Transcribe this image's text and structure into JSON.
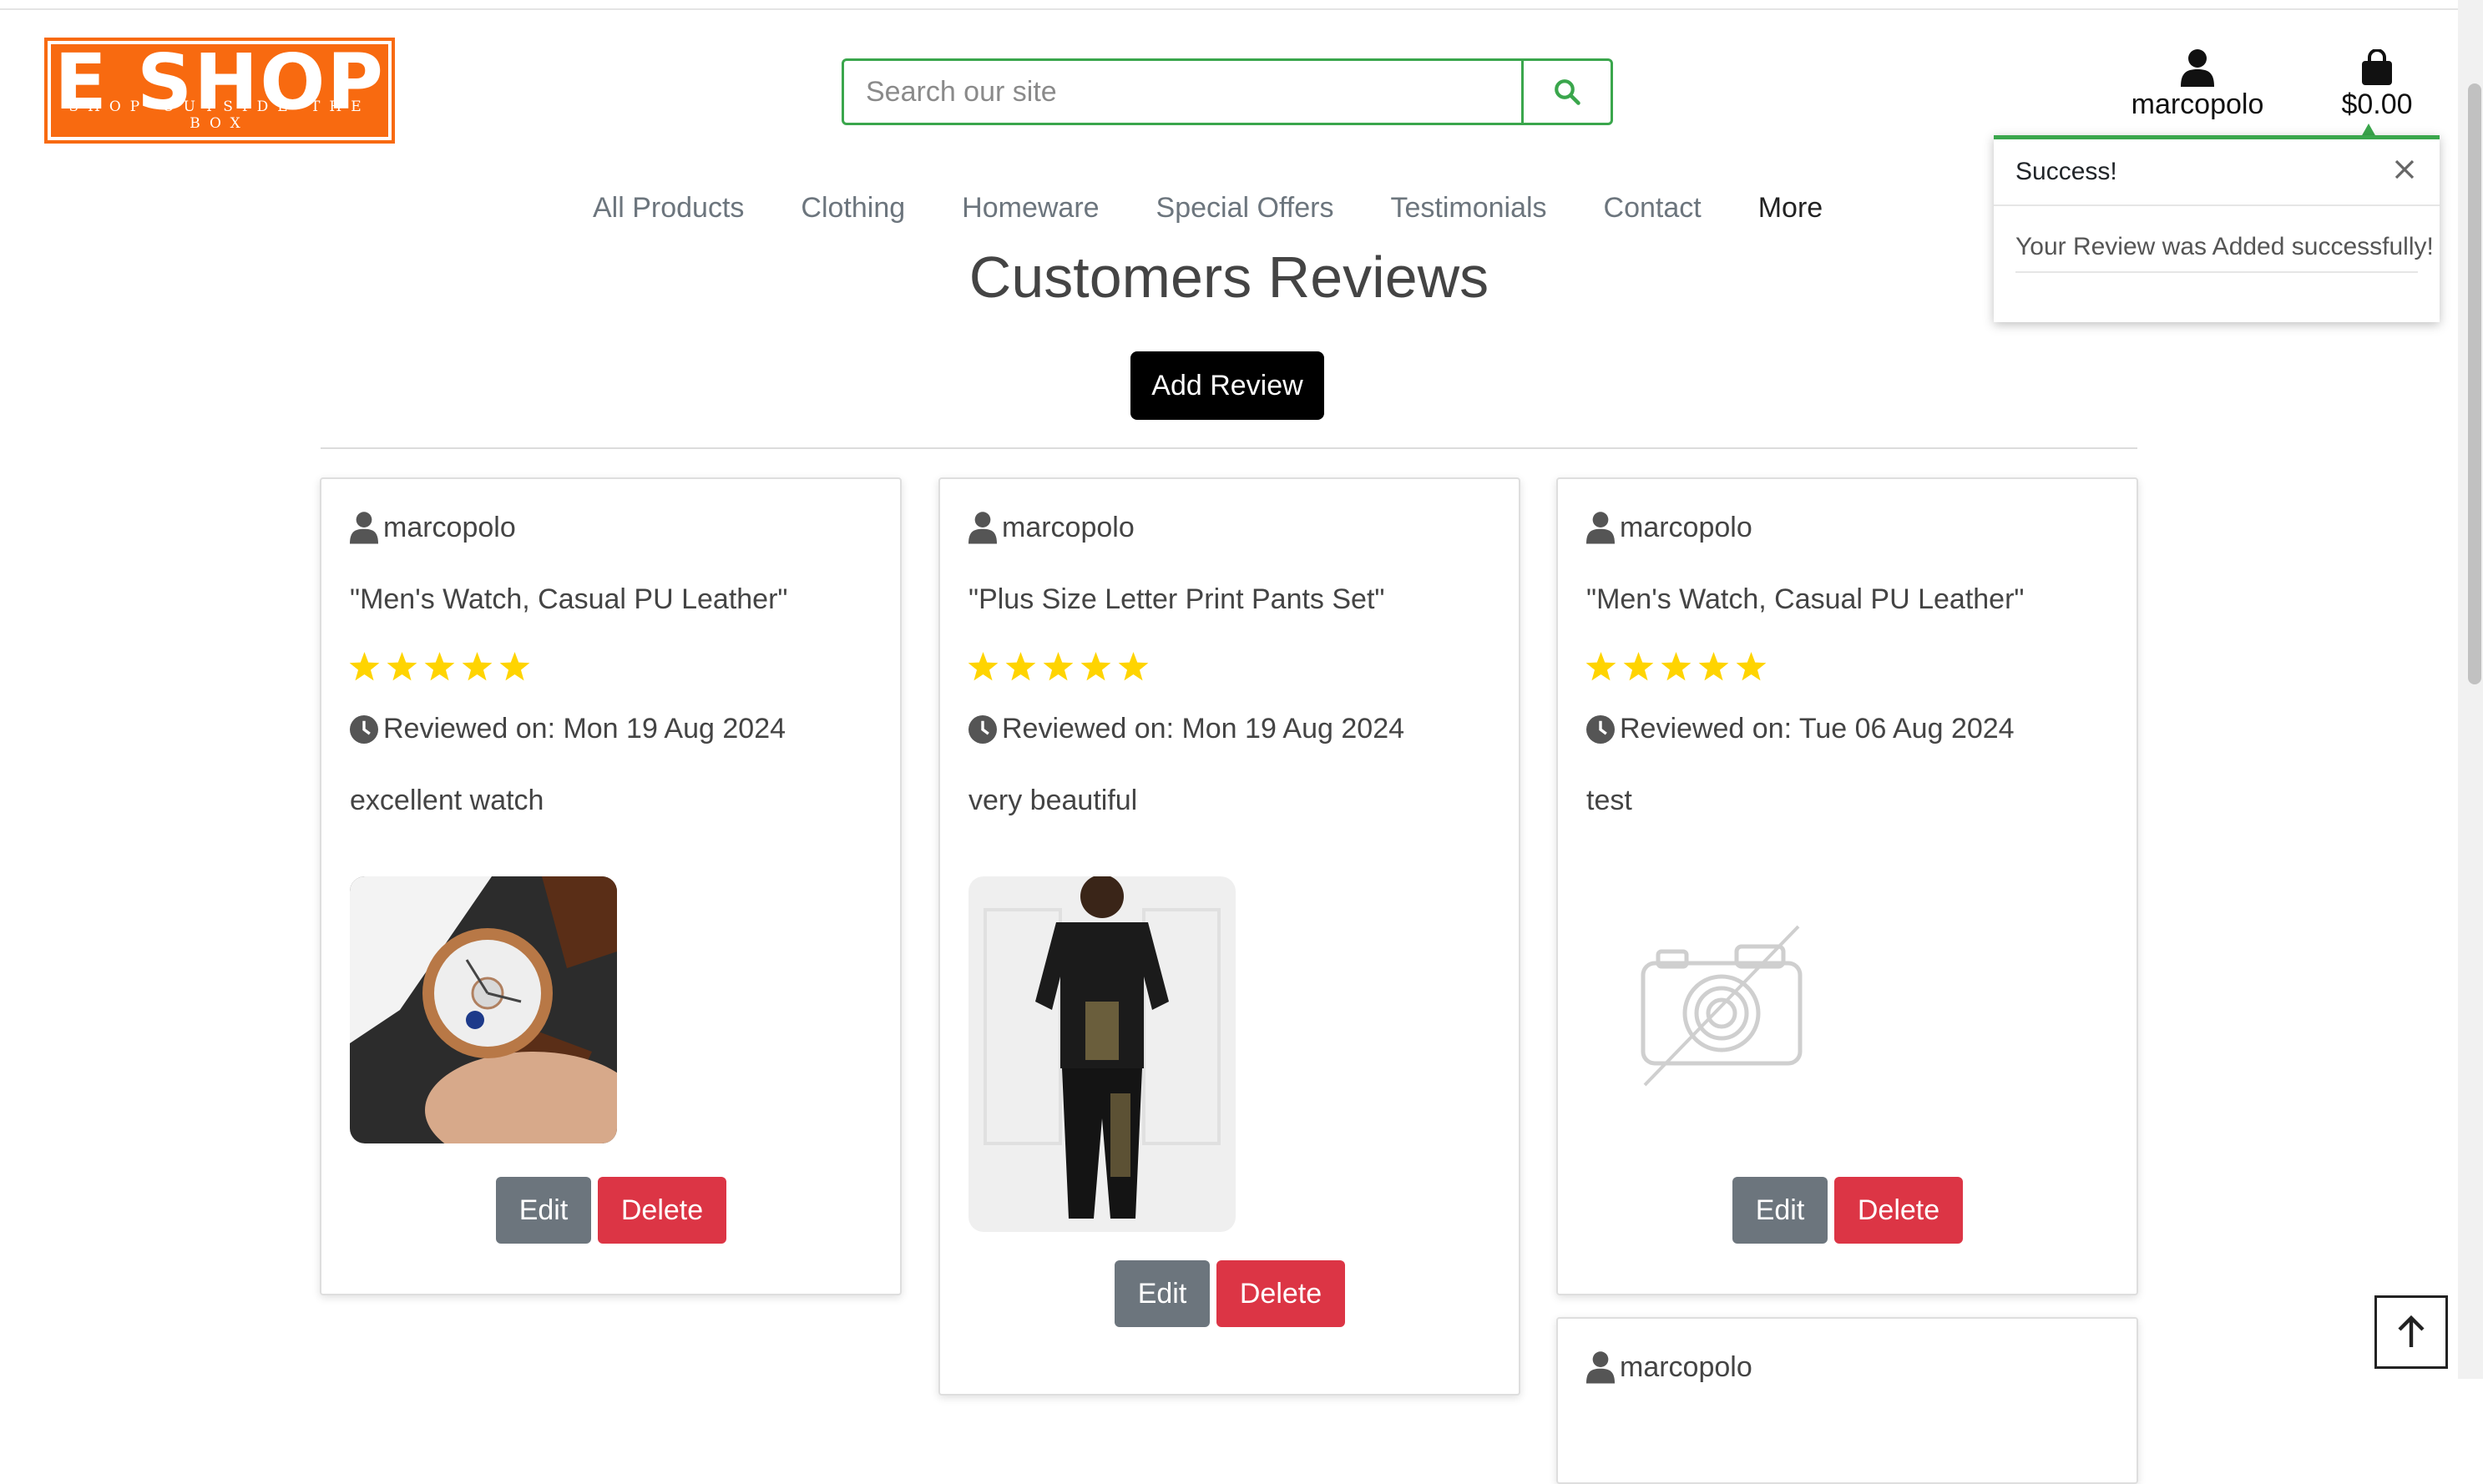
{
  "logo": {
    "main": "E SHOP",
    "tagline": "SHOP OUTSIDE THE BOX"
  },
  "search": {
    "placeholder": "Search our site"
  },
  "account": {
    "username": "marcopolo"
  },
  "cart": {
    "total": "$0.00"
  },
  "toast": {
    "title": "Success!",
    "message": "Your Review was Added successfully!"
  },
  "nav": {
    "items": [
      "All Products",
      "Clothing",
      "Homeware",
      "Special Offers",
      "Testimonials",
      "Contact"
    ],
    "more": "More"
  },
  "page": {
    "title": "Customers Reviews",
    "add_button": "Add Review"
  },
  "reviews": [
    {
      "user": "marcopolo",
      "product": "\"Men's Watch, Casual PU Leather\"",
      "rating": 5,
      "date": "Reviewed on: Mon 19 Aug 2024",
      "comment": "excellent watch",
      "image": "watch-photo",
      "edit": "Edit",
      "delete": "Delete"
    },
    {
      "user": "marcopolo",
      "product": "\"Plus Size Letter Print Pants Set\"",
      "rating": 5,
      "date": "Reviewed on: Mon 19 Aug 2024",
      "comment": "very beautiful",
      "image": "pants-set-photo",
      "edit": "Edit",
      "delete": "Delete"
    },
    {
      "user": "marcopolo",
      "product": "\"Men's Watch, Casual PU Leather\"",
      "rating": 5,
      "date": "Reviewed on: Tue 06 Aug 2024",
      "comment": "test",
      "image": "no-image-placeholder",
      "edit": "Edit",
      "delete": "Delete"
    },
    {
      "user": "marcopolo"
    }
  ],
  "colors": {
    "brand": "#f86a10",
    "accent_green": "#3aa64c",
    "star": "#ffd400",
    "edit": "#6c757d",
    "delete": "#dc3545"
  }
}
